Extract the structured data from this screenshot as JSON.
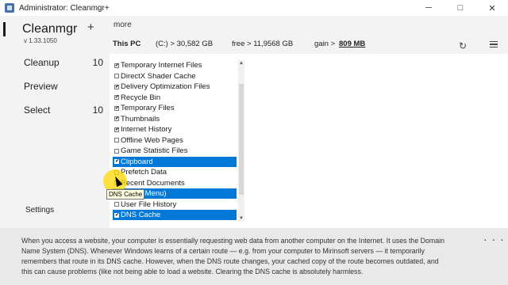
{
  "window": {
    "title": "Administrator: Cleanmgr+",
    "minimize": "─",
    "maximize": "□",
    "close": "✕"
  },
  "sidebar": {
    "app_name": "Cleanmgr",
    "add_label": "+",
    "version": "v 1.33.1050",
    "items": [
      {
        "label": "Cleanup",
        "count": "10"
      },
      {
        "label": "Preview",
        "count": ""
      },
      {
        "label": "Select",
        "count": "10"
      }
    ],
    "settings_label": "Settings"
  },
  "toolbar": {
    "more_label": "more",
    "this_pc": "This PC",
    "drive": "(C:) > 30,582 GB",
    "free": "free > 11,9568 GB",
    "gain_label": "gain >",
    "gain_value": "809 MB",
    "refresh_icon": "↻"
  },
  "list": {
    "items": [
      {
        "label": "Temporary Internet Files",
        "checked": true,
        "selected": false
      },
      {
        "label": "DirectX Shader Cache",
        "checked": false,
        "selected": false
      },
      {
        "label": "Delivery Optimization Files",
        "checked": true,
        "selected": false
      },
      {
        "label": "Recycle Bin",
        "checked": true,
        "selected": false
      },
      {
        "label": "Temporary Files",
        "checked": true,
        "selected": false
      },
      {
        "label": "Thumbnails",
        "checked": true,
        "selected": false
      },
      {
        "label": "Internet History",
        "checked": true,
        "selected": false
      },
      {
        "label": "Offline Web Pages",
        "checked": false,
        "selected": false
      },
      {
        "label": "Game Statistic Files",
        "checked": false,
        "selected": false
      },
      {
        "label": "Clipboard",
        "checked": true,
        "selected": true
      },
      {
        "label": "Prefetch Data",
        "checked": false,
        "selected": false
      },
      {
        "label": "Recent Documents",
        "checked": false,
        "selected": false
      },
      {
        "label": "n Start Menu)",
        "checked": false,
        "selected": true
      },
      {
        "label": "User File History",
        "checked": false,
        "selected": false
      },
      {
        "label": "DNS Cache",
        "checked": true,
        "selected": true
      }
    ],
    "scroll_up": "▲",
    "scroll_down": "▼"
  },
  "tooltip": "DNS Cache",
  "description": "When you access a website, your computer is essentially requesting web data from another computer on the Internet. It uses the Domain Name System (DNS). Whenever Windows learns of a certain route — e.g. from your computer to Mirinsoft servers — it temporarily remembers that route in its DNS cache. However, when the DNS route changes, your cached copy of the route becomes outdated, and this can cause problems (like not being able to load a website. Clearing the DNS cache is absolutely harmless.",
  "more_dots": "· · ·",
  "colors": {
    "selection": "#0078d7",
    "tooltip_bg": "#ffffe1",
    "cursor_highlight": "#ffd700"
  }
}
